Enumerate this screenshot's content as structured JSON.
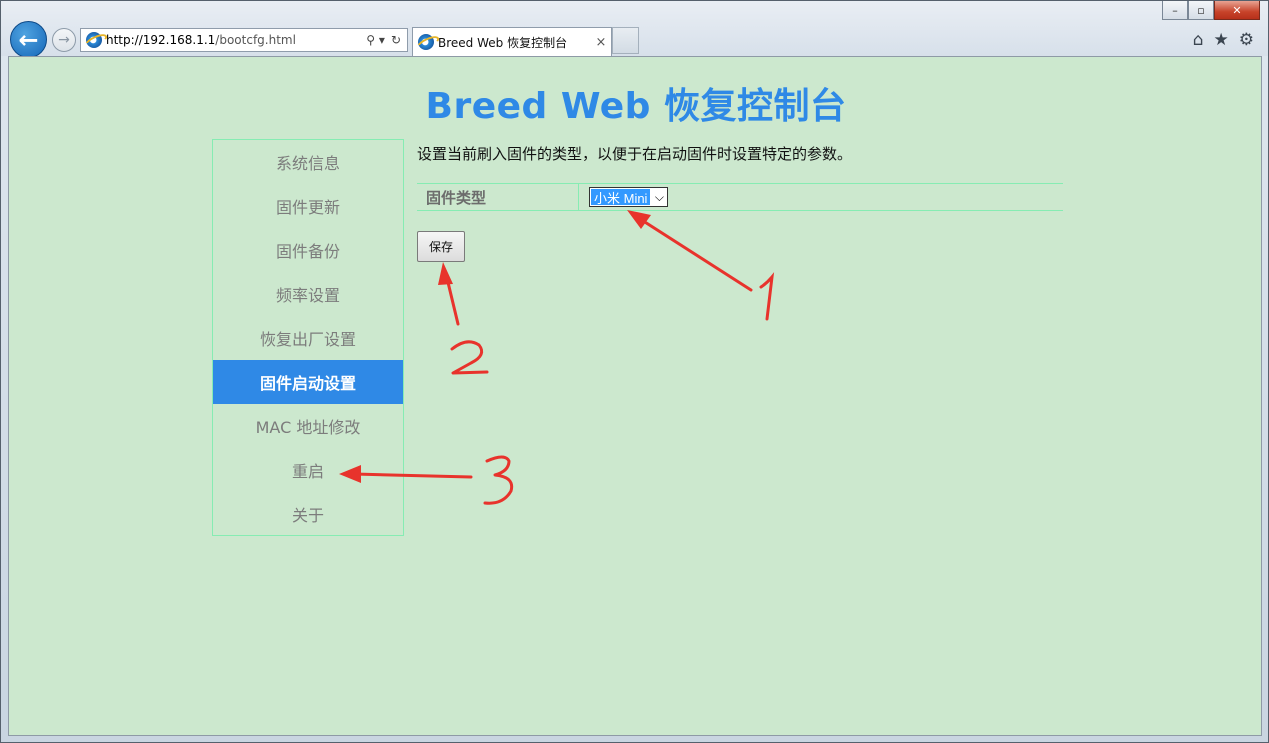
{
  "browser": {
    "url_host": "http://192.168.1.1",
    "url_path": "/bootcfg.html",
    "tab_title": "Breed Web 恢复控制台",
    "tab_close": "×",
    "window_controls": {
      "minimize": "–",
      "maximize": "▫",
      "close": "✕"
    },
    "address_tools": {
      "search": "⚲ ▾",
      "refresh": "↻"
    },
    "right_tools": {
      "home": "⌂",
      "favorites": "★",
      "settings": "⚙"
    },
    "nav": {
      "back": "←",
      "forward": "→"
    }
  },
  "page": {
    "title": "Breed Web 恢复控制台",
    "description": "设置当前刷入固件的类型，以便于在启动固件时设置特定的参数。"
  },
  "sidebar": {
    "items": [
      {
        "label": "系统信息",
        "active": false
      },
      {
        "label": "固件更新",
        "active": false
      },
      {
        "label": "固件备份",
        "active": false
      },
      {
        "label": "频率设置",
        "active": false
      },
      {
        "label": "恢复出厂设置",
        "active": false
      },
      {
        "label": "固件启动设置",
        "active": true
      },
      {
        "label": "MAC 地址修改",
        "active": false
      },
      {
        "label": "重启",
        "active": false
      },
      {
        "label": "关于",
        "active": false
      }
    ]
  },
  "form": {
    "firmware_type_label": "固件类型",
    "firmware_type_value": "小米 Mini",
    "select_arrow": "⌵",
    "save_label": "保存"
  },
  "annotations": {
    "color": "#e8332c",
    "labels": [
      "1",
      "2",
      "3"
    ]
  },
  "colors": {
    "accent": "#2f89e6",
    "page_bg": "#cce8ce",
    "border": "#86ecb3"
  }
}
